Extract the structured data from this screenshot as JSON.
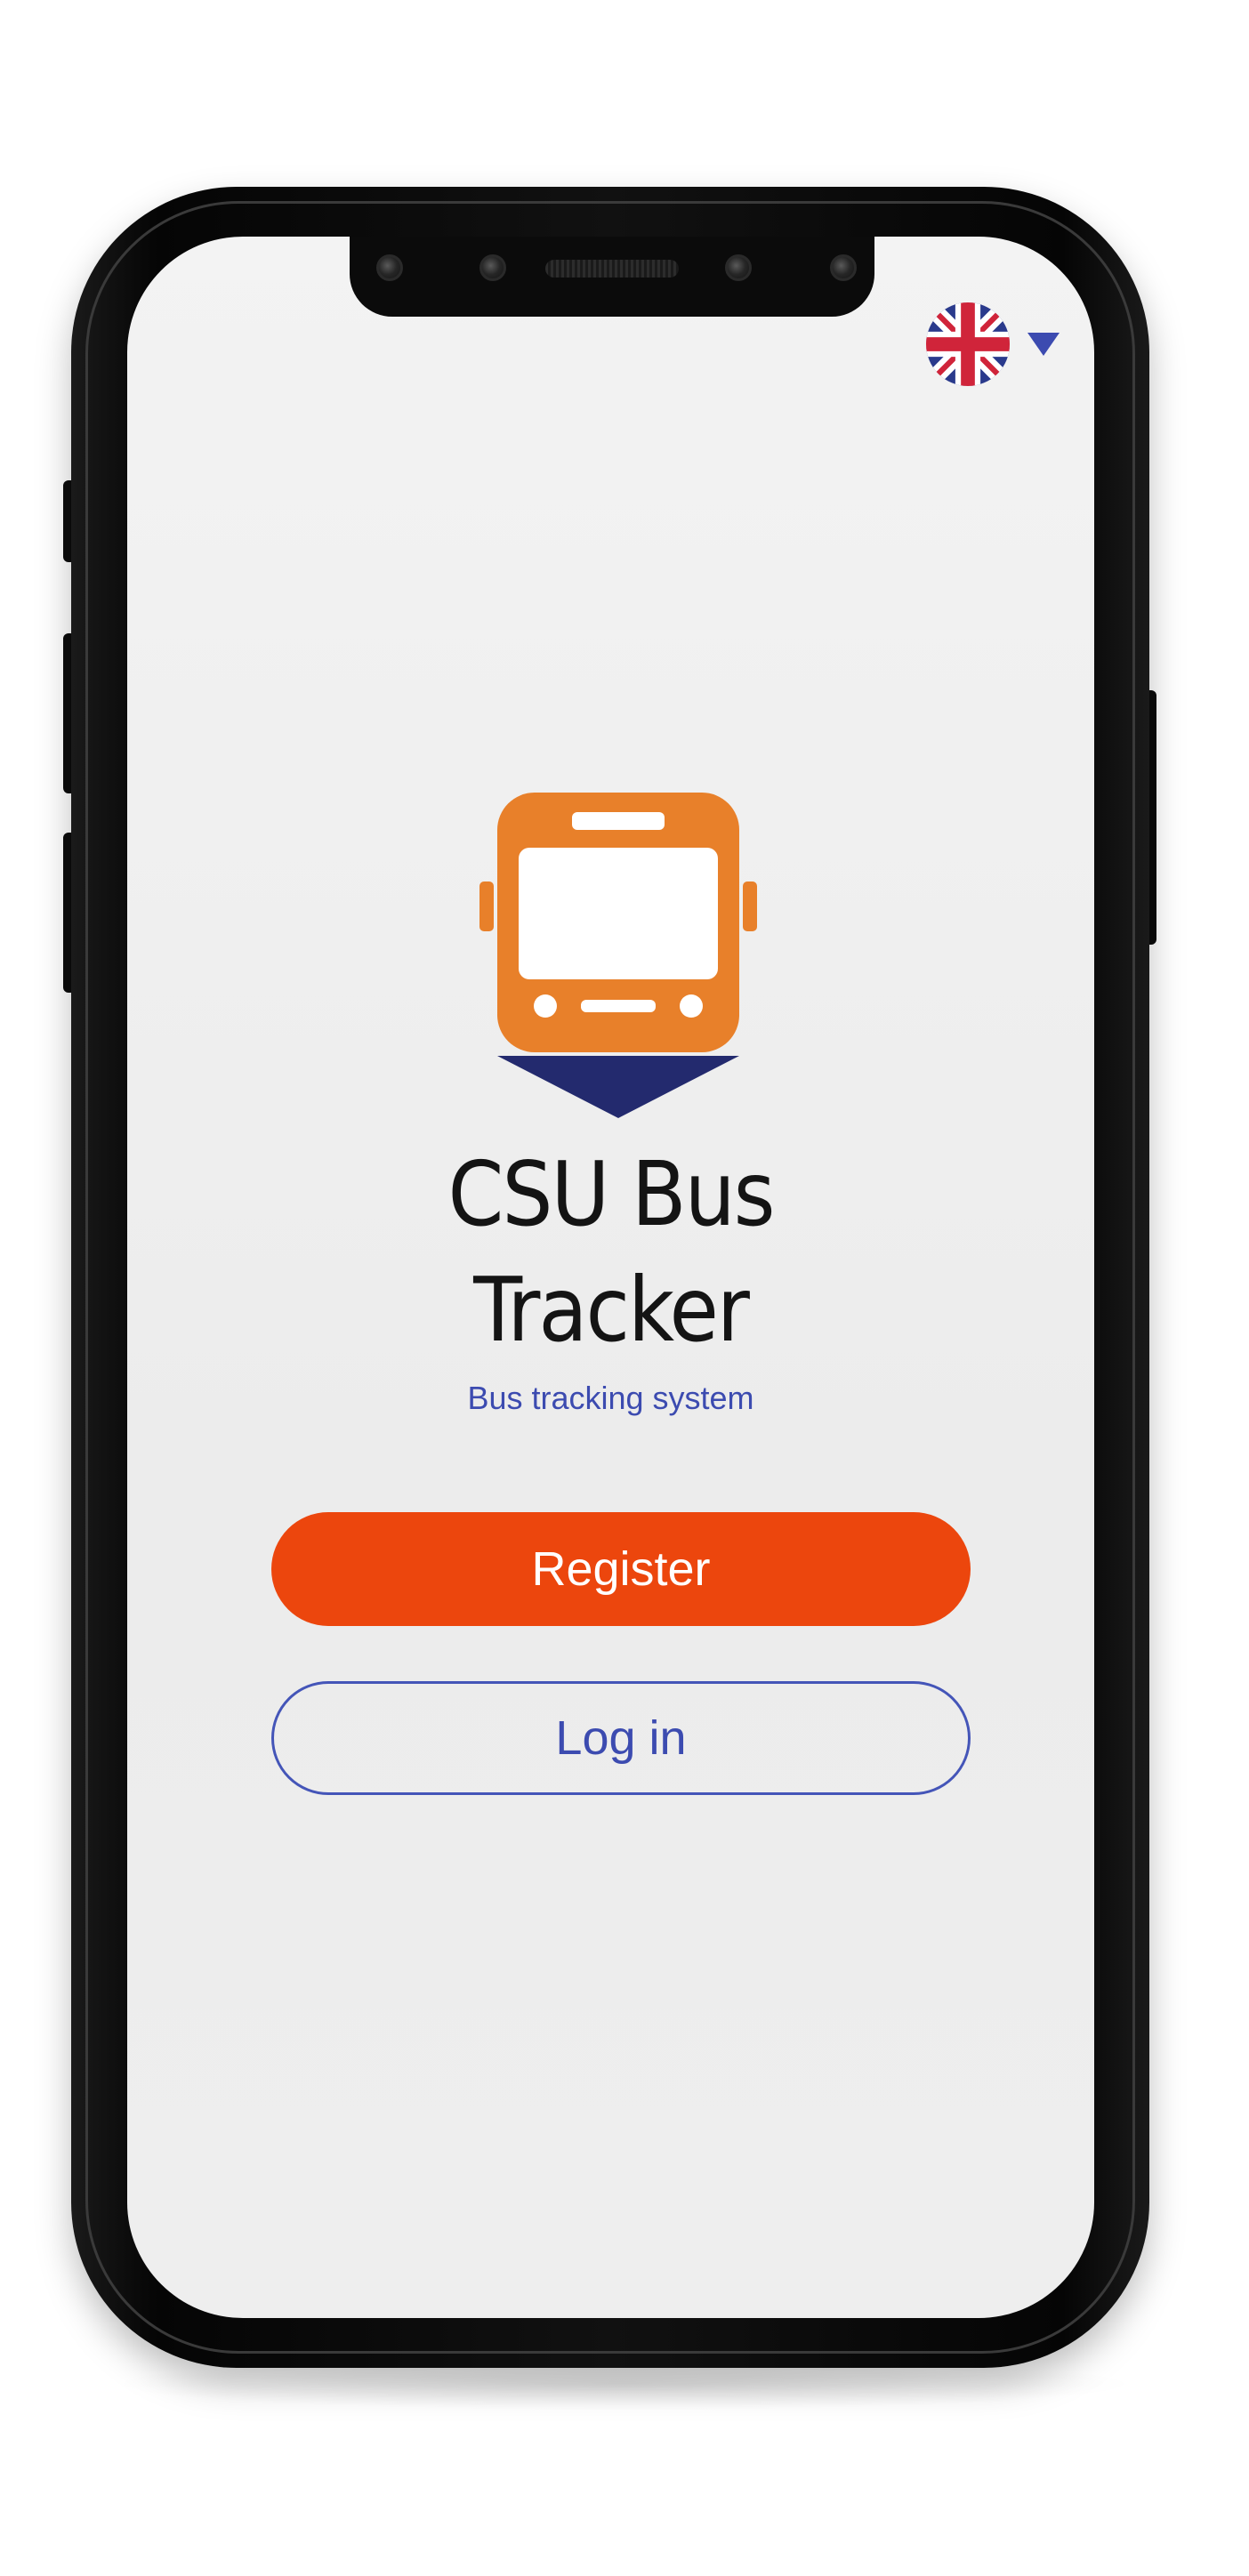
{
  "app": {
    "title_line1": "CSU Bus",
    "title_line2": "Tracker",
    "subtitle": "Bus tracking system"
  },
  "language": {
    "selected": "English (UK)",
    "flag_icon": "uk-flag-icon",
    "dropdown_icon": "caret-down-icon"
  },
  "actions": {
    "register_label": "Register",
    "login_label": "Log in"
  },
  "colors": {
    "primary": "#ec460d",
    "secondary": "#3c4bb0",
    "logo_bus": "#e8802a",
    "logo_pointer": "#232a6e",
    "screen_bg": "#efefef"
  }
}
